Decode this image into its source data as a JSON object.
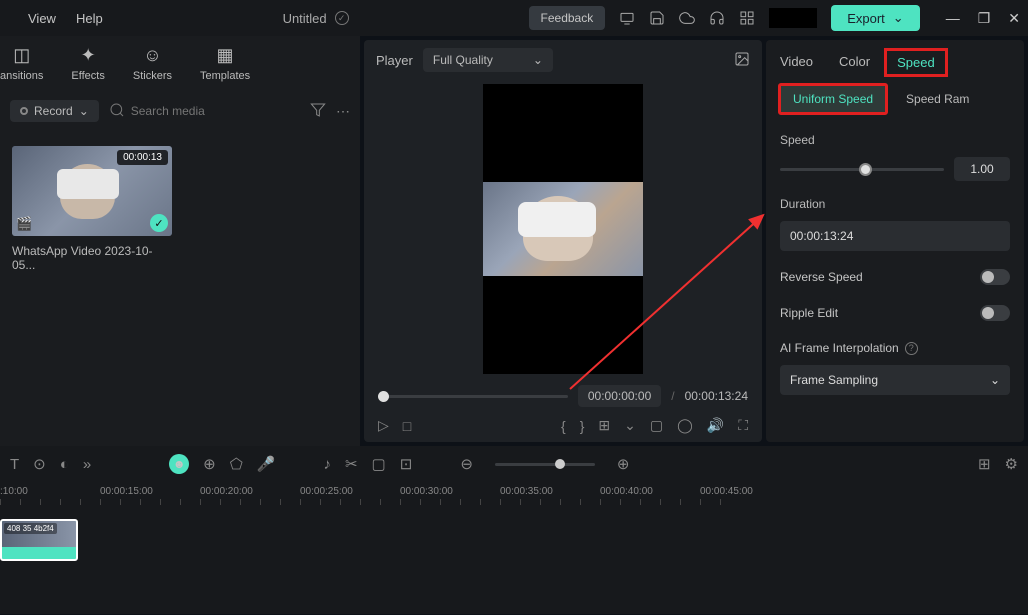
{
  "menu": {
    "view": "View",
    "help": "Help"
  },
  "title": "Untitled",
  "topbar": {
    "feedback": "Feedback",
    "export": "Export"
  },
  "leftTabs": {
    "transitions": "ansitions",
    "effects": "Effects",
    "stickers": "Stickers",
    "templates": "Templates"
  },
  "record": "Record",
  "searchPlaceholder": "Search media",
  "media": {
    "duration": "00:00:13",
    "name": "WhatsApp Video 2023-10-05..."
  },
  "player": {
    "label": "Player",
    "quality": "Full Quality",
    "currentTime": "00:00:00:00",
    "separator": "/",
    "totalTime": "00:00:13:24"
  },
  "rightPanel": {
    "tabs": {
      "video": "Video",
      "color": "Color",
      "speed": "Speed"
    },
    "subtabs": {
      "uniform": "Uniform Speed",
      "ramp": "Speed Ram"
    },
    "speedLabel": "Speed",
    "speedValue": "1.00",
    "durationLabel": "Duration",
    "durationValue": "00:00:13:24",
    "reverseSpeed": "Reverse Speed",
    "rippleEdit": "Ripple Edit",
    "aiLabel": "AI Frame Interpolation",
    "frameSampling": "Frame Sampling"
  },
  "timeline": {
    "marks": [
      ":10:00",
      "00:00:15:00",
      "00:00:20:00",
      "00:00:25:00",
      "00:00:30:00",
      "00:00:35:00",
      "00:00:40:00",
      "00:00:45:00"
    ],
    "clipLabel": "408 35 4b2f4"
  }
}
